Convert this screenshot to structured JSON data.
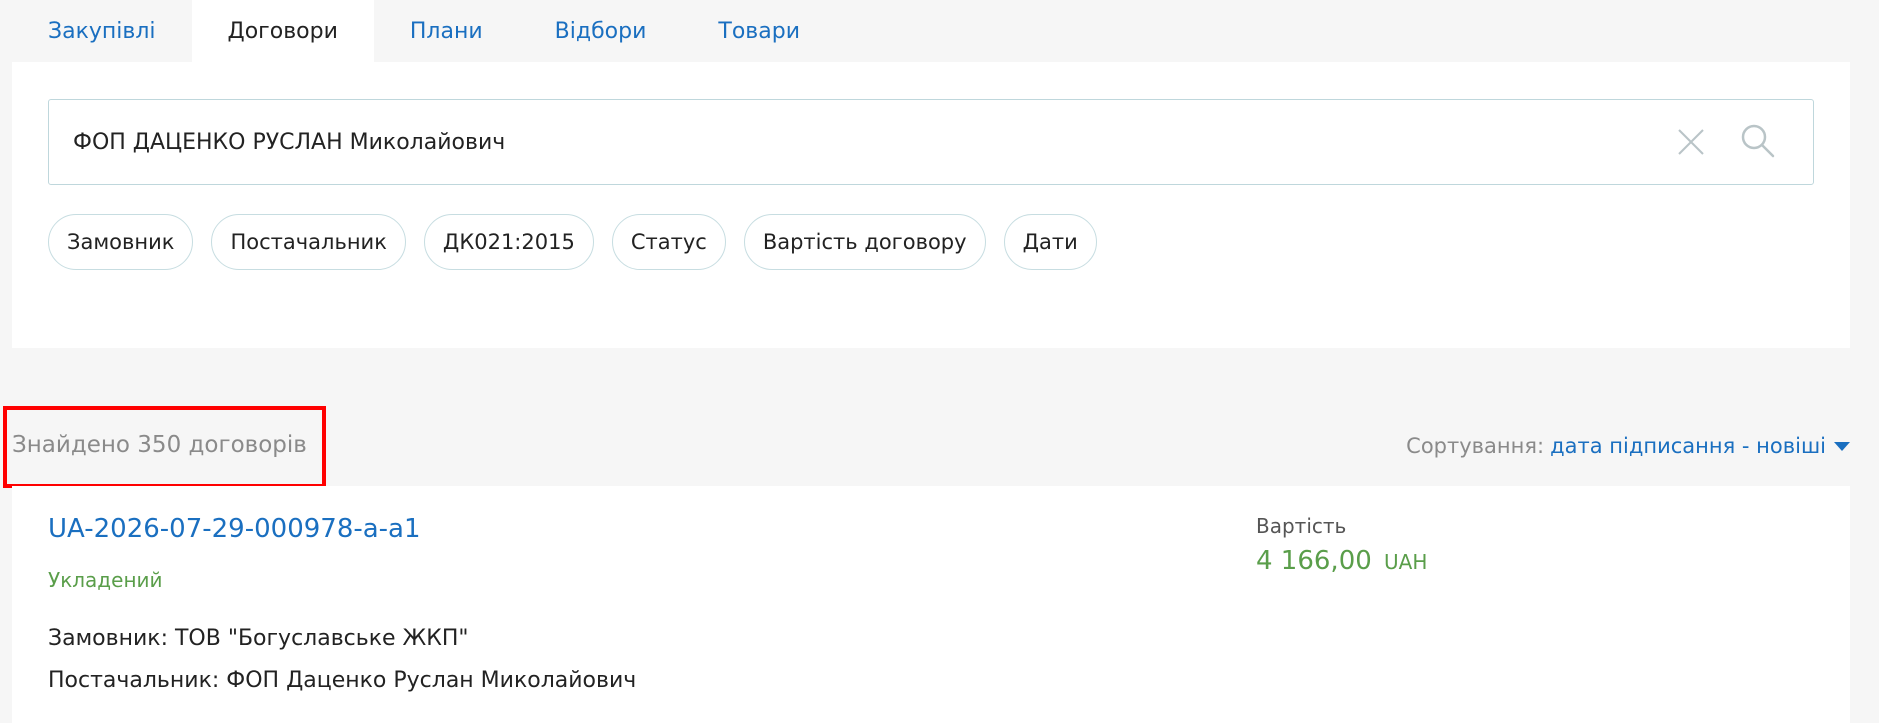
{
  "tabs": [
    {
      "label": "Закупівлі",
      "active": false
    },
    {
      "label": "Договори",
      "active": true
    },
    {
      "label": "Плани",
      "active": false
    },
    {
      "label": "Відбори",
      "active": false
    },
    {
      "label": "Товари",
      "active": false
    }
  ],
  "search": {
    "value": "ФОП ДАЦЕНКО РУСЛАН Миколайович",
    "clear_icon": "close-icon",
    "search_icon": "search-icon"
  },
  "filters": [
    {
      "label": "Замовник"
    },
    {
      "label": "Постачальник"
    },
    {
      "label": "ДК021:2015"
    },
    {
      "label": "Статус"
    },
    {
      "label": "Вартість договору"
    },
    {
      "label": "Дати"
    }
  ],
  "results": {
    "found_text": "Знайдено 350 договорів",
    "sort_label": "Сортування:",
    "sort_value": "дата підписання - новіші"
  },
  "contract": {
    "id": "UA-2026-07-29-000978-a-a1",
    "status": "Укладений",
    "customer": "Замовник: ТОВ \"Богуславське ЖКП\"",
    "supplier": "Постачальник: ФОП Даценко Руслан Миколайович",
    "price_label": "Вартість",
    "price_amount": "4 166,00",
    "price_currency": "UAH"
  },
  "colors": {
    "link": "#1a6fc0",
    "status_green": "#5a9e4a",
    "highlight": "#ff0000"
  }
}
